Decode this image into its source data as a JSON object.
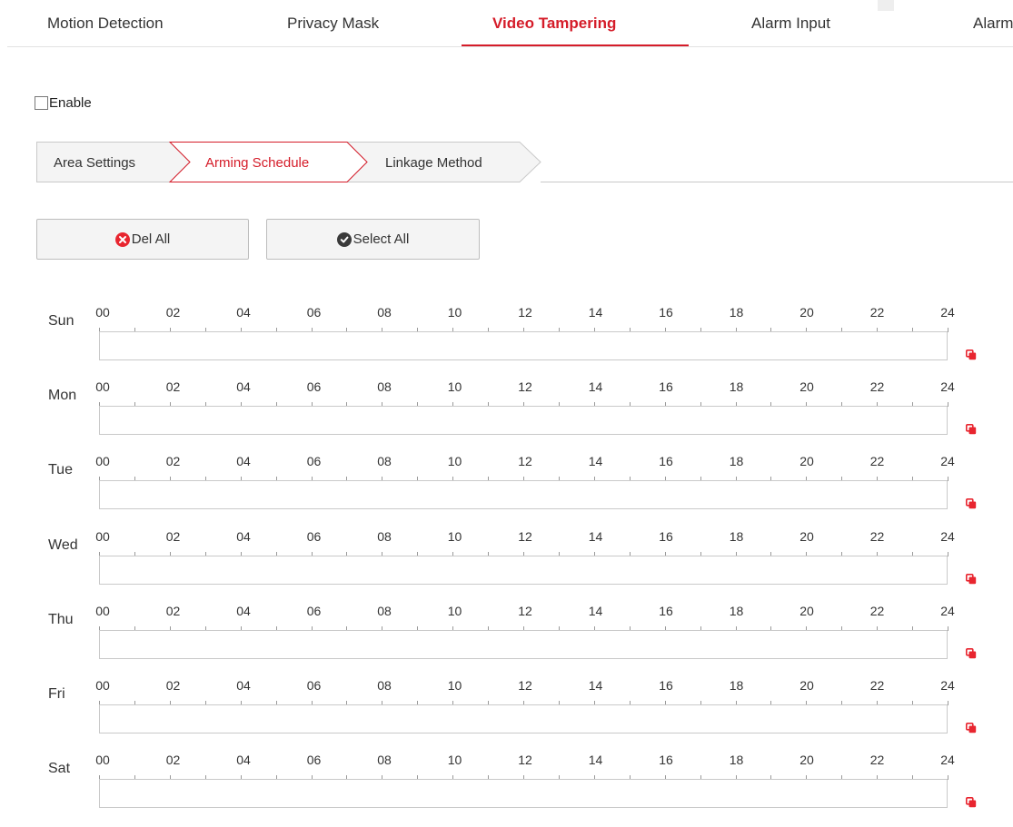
{
  "top_tabs": [
    {
      "label": "Motion Detection",
      "active": false
    },
    {
      "label": "Privacy Mask",
      "active": false
    },
    {
      "label": "Video Tampering",
      "active": true
    },
    {
      "label": "Alarm Input",
      "active": false
    },
    {
      "label": "Alarm",
      "active": false
    }
  ],
  "enable": {
    "label": "Enable",
    "checked": false
  },
  "steps": [
    {
      "label": "Area Settings",
      "active": false
    },
    {
      "label": "Arming Schedule",
      "active": true
    },
    {
      "label": "Linkage Method",
      "active": false
    }
  ],
  "buttons": {
    "del_all": "Del All",
    "select_all": "Select All"
  },
  "hour_labels": [
    "00",
    "02",
    "04",
    "06",
    "08",
    "10",
    "12",
    "14",
    "16",
    "18",
    "20",
    "22",
    "24"
  ],
  "days": [
    {
      "label": "Sun"
    },
    {
      "label": "Mon"
    },
    {
      "label": "Tue"
    },
    {
      "label": "Wed"
    },
    {
      "label": "Thu"
    },
    {
      "label": "Fri"
    },
    {
      "label": "Sat"
    }
  ],
  "colors": {
    "accent": "#d51c29",
    "text": "#333333",
    "border": "#c9c9c9",
    "button_bg": "#f4f4f4"
  },
  "icons": {
    "del_all": "x-circle-icon",
    "select_all": "check-circle-icon",
    "copy": "copy-icon"
  }
}
